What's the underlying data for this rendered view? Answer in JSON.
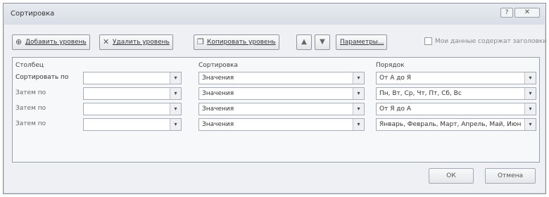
{
  "window": {
    "title": "Сортировка",
    "help_label": "?",
    "close_label": "✕"
  },
  "toolbar": {
    "add_level": "Добавить уровень",
    "delete_level": "Удалить уровень",
    "copy_level": "Копировать уровень",
    "move_up": "▲",
    "move_down": "▼",
    "options": "Параметры...",
    "header_checkbox_label": "Мои данные содержат заголовки",
    "header_checkbox_checked": false
  },
  "grid": {
    "headers": {
      "column": "Столбец",
      "sort_on": "Сортировка",
      "order": "Порядок"
    },
    "rows": [
      {
        "label": "Сортировать по",
        "column_value": "",
        "sort_on": "Значения",
        "order": "От А до Я"
      },
      {
        "label": "Затем по",
        "column_value": "",
        "sort_on": "Значения",
        "order": "Пн, Вт, Ср, Чт, Пт, Сб, Вс"
      },
      {
        "label": "Затем по",
        "column_value": "",
        "sort_on": "Значения",
        "order": "От Я до А"
      },
      {
        "label": "Затем по",
        "column_value": "",
        "sort_on": "Значения",
        "order": "Январь, Февраль, Март, Апрель, Май, Июнь"
      }
    ]
  },
  "footer": {
    "ok": "ОК",
    "cancel": "Отмена"
  },
  "icons": {
    "dropdown_arrow": "▾"
  }
}
